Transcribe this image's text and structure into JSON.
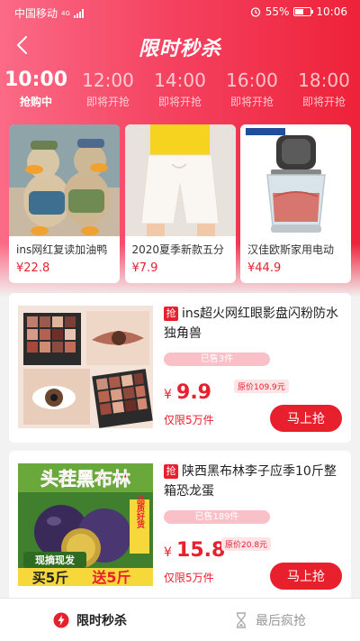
{
  "status_bar": {
    "carrier": "中国移动",
    "network": "4G",
    "battery": "55%",
    "time": "10:06"
  },
  "header": {
    "title": "限时秒杀"
  },
  "time_tabs": [
    {
      "time": "10:00",
      "status": "抢购中",
      "active": true
    },
    {
      "time": "12:00",
      "status": "即将开抢",
      "active": false
    },
    {
      "time": "14:00",
      "status": "即将开抢",
      "active": false
    },
    {
      "time": "16:00",
      "status": "即将开抢",
      "active": false
    },
    {
      "time": "18:00",
      "status": "即将开抢",
      "active": false
    }
  ],
  "featured": [
    {
      "name": "ins网红复读加油鸭",
      "price": "¥22.8"
    },
    {
      "name": "2020夏季新款五分",
      "price": "¥7.9"
    },
    {
      "name": "汉佳欧斯家用电动",
      "price": "¥44.9"
    }
  ],
  "products": [
    {
      "tag": "抢",
      "title": "ins超火网红眼影盘闪粉防水独角兽",
      "sold": "已售3件",
      "currency": "¥",
      "price": "9.9",
      "original": "原价109.9元",
      "limit": "仅限5万件",
      "button": "马上抢"
    },
    {
      "tag": "抢",
      "title": "陕西黑布林李子应季10斤整箱恐龙蛋",
      "sold": "已售189件",
      "currency": "¥",
      "price": "15.8",
      "original": "原价20.8元",
      "limit": "仅限5万件",
      "button": "马上抢",
      "image_text": {
        "banner": "头茬黑布林",
        "side": "品质好货",
        "note": "现摘现发",
        "deal_prefix": "买5斤",
        "deal_suffix": "送5斤"
      }
    }
  ],
  "tab_bar": [
    {
      "label": "限时秒杀",
      "icon": "lightning-icon",
      "active": true
    },
    {
      "label": "最后疯抢",
      "icon": "hourglass-icon",
      "active": false
    }
  ],
  "colors": {
    "accent": "#e8202e",
    "header_start": "#fb6a86",
    "header_end": "#ee2239"
  }
}
